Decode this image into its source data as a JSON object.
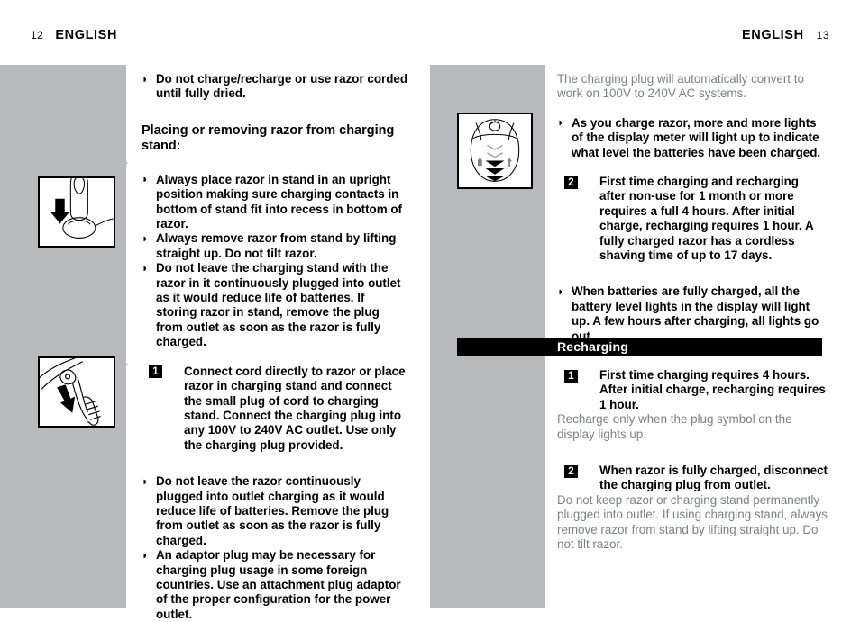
{
  "page": {
    "left_folio": "12",
    "left_runhead": "ENGLISH",
    "right_runhead": "ENGLISH",
    "right_folio": "13",
    "band_color": "#b7b9bd",
    "gray_text_color": "#7d8085"
  },
  "figures": {
    "stand": {
      "caption_name": "razor-inserted-into-charging-stand-illustration"
    },
    "plug": {
      "caption_name": "small-plug-connecting-to-stand-illustration"
    },
    "display": {
      "caption_name": "razor-display-meter-illustration"
    }
  },
  "left_column": {
    "intro_bullets": [
      "Do not charge/recharge or use razor corded until fully dried."
    ],
    "section_heading": "Placing or removing razor from charging stand:",
    "stand_bullets": [
      "Always place razor in stand in an upright position making sure charging contacts in bottom of stand fit into recess in bottom of razor.",
      "Always remove razor from stand by lifting straight up. Do not tilt razor.",
      "Do not leave the charging stand with the razor in it continuously plugged into outlet as it would reduce life of batteries. If storing razor in stand, remove the plug from outlet as soon as the razor is fully charged."
    ],
    "step_one": {
      "number": "1",
      "text": "Connect cord directly to razor or place razor in charging stand and connect the small plug of cord to charging stand. Connect the charging plug into any 100V to 240V AC outlet. Use only the charging plug provided."
    },
    "closing_bullets": [
      "Do not leave the razor continuously plugged into outlet charging as it would reduce life of batteries. Remove the plug from outlet as soon as the razor is fully charged.",
      "An adaptor plug may be necessary for charging plug usage in some foreign countries. Use an attachment plug adaptor of the proper configuration for the power outlet."
    ]
  },
  "right_column": {
    "intro_paragraph": "The charging plug will automatically convert to work on 100V to 240V AC systems.",
    "charge_bullet": "As you charge razor, more and more lights of the display meter will light up to indicate what level the batteries have been charged.",
    "step_two": {
      "number": "2",
      "text": "First time charging and recharging after non-use for 1 month or more requires a full 4 hours. After initial charge, recharging requires 1 hour. A fully charged razor has a cordless shaving time of up to 17 days."
    },
    "full_charge_bullet": "When batteries are fully charged, all the battery level lights in the display will light up. A few hours after charging, all lights go out.",
    "section_bar_label": "Recharging",
    "recharge_step_one": {
      "number": "1",
      "text": "First time charging requires 4 hours.  After initial charge, recharging requires 1 hour."
    },
    "recharge_note_one": "Recharge only when the plug symbol on the display lights up.",
    "recharge_step_two": {
      "number": "2",
      "text": "When razor is fully charged, disconnect the charging plug from outlet."
    },
    "recharge_note_two": "Do not keep razor or charging stand permanently plugged into outlet.  If using charging stand, always remove razor from stand by lifting straight up. Do not tilt razor."
  }
}
